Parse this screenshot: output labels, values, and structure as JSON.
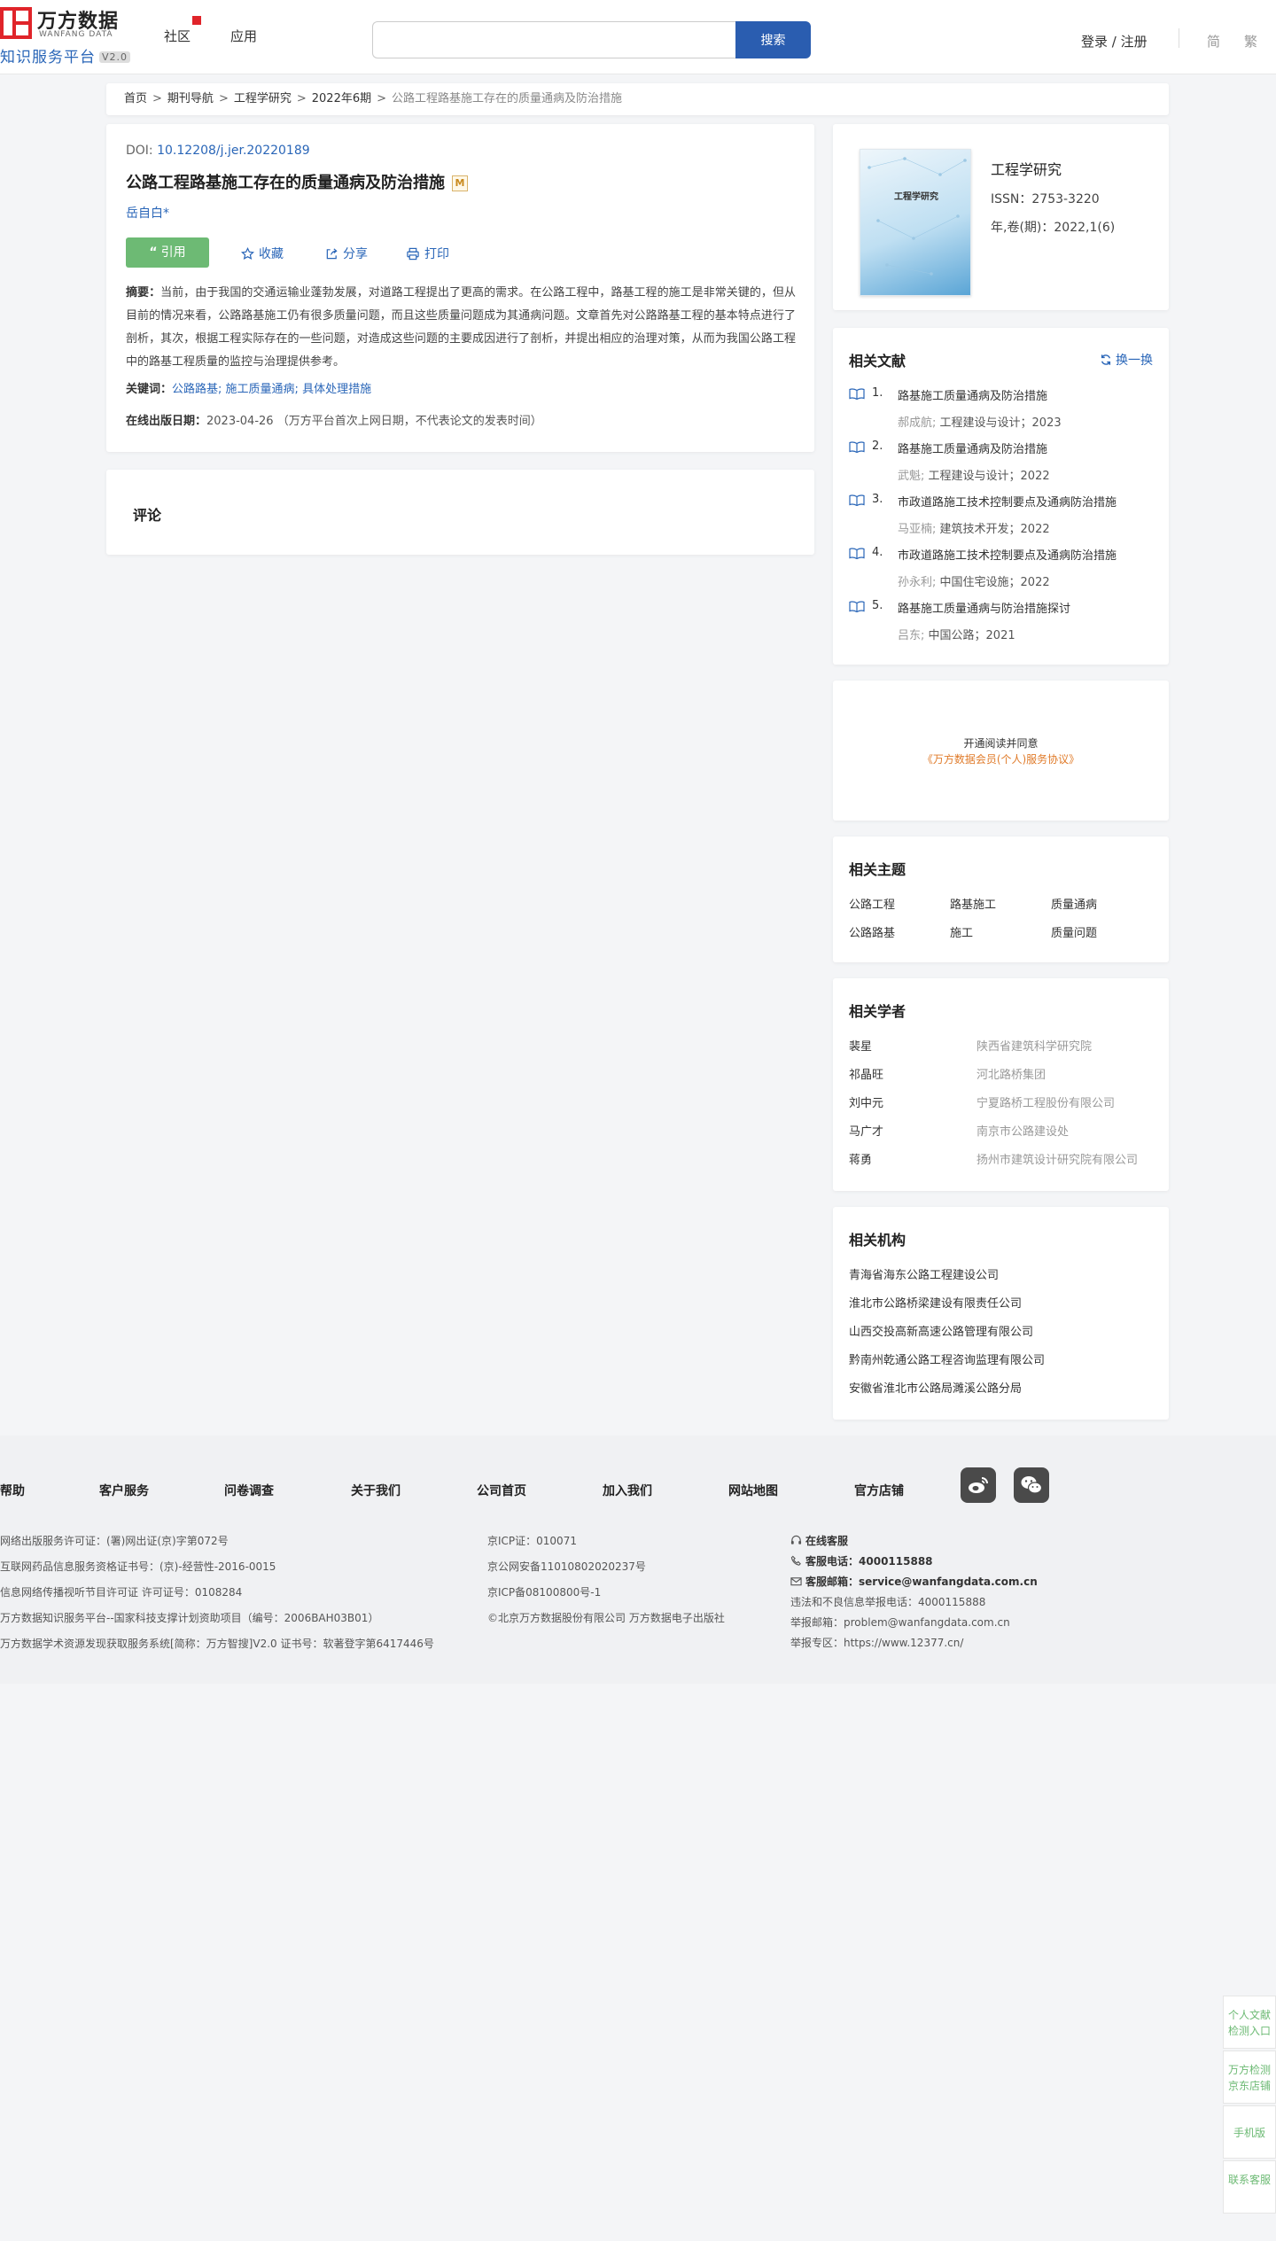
{
  "header": {
    "logo_cn": "万方数据",
    "logo_en": "WANFANG DATA",
    "logo_sub": "知识服务平台",
    "version": "V2.0",
    "nav": [
      "社区",
      "应用"
    ],
    "search_placeholder": "",
    "search_btn": "搜索",
    "login": "登录 / 注册",
    "lang_simplified": "简",
    "lang_traditional": "繁"
  },
  "breadcrumb": {
    "items": [
      "首页",
      "期刊导航",
      "工程学研究",
      "2022年6期"
    ],
    "current": "公路工程路基施工存在的质量通病及防治措施",
    "sep": ">"
  },
  "article": {
    "doi_label": "DOI:",
    "doi": "10.12208/j.jer.20220189",
    "title": "公路工程路基施工存在的质量通病及防治措施",
    "m_badge": "M",
    "author": "岳自白*",
    "cite": "引用",
    "favorite": "收藏",
    "share": "分享",
    "print": "打印",
    "abstract_label": "摘要：",
    "abstract": "当前，由于我国的交通运输业蓬勃发展，对道路工程提出了更高的需求。在公路工程中，路基工程的施工是非常关键的，但从目前的情况来看，公路路基施工仍有很多质量问题，而且这些质量问题成为其通病问题。文章首先对公路路基工程的基本特点进行了剖析，其次，根据工程实际存在的一些问题，对造成这些问题的主要成因进行了剖析，并提出相应的治理对策，从而为我国公路工程中的路基工程质量的监控与治理提供参考。",
    "keywords_label": "关键词：",
    "keywords": [
      "公路路基;",
      "施工质量通病;",
      "具体处理措施"
    ],
    "pubdate_label": "在线出版日期：",
    "pubdate": "2023-04-26",
    "pubdate_note": "（万方平台首次上网日期，不代表论文的发表时间）"
  },
  "comment": {
    "title": "评论"
  },
  "journal": {
    "cover_title": "工程学研究",
    "name": "工程学研究",
    "issn": "ISSN：2753-3220",
    "volume": "年,卷(期)：2022,1(6)"
  },
  "related": {
    "title": "相关文献",
    "refresh": "换一换",
    "items": [
      {
        "num": "1.",
        "title": "路基施工质量通病及防治措施",
        "author": "郝成航;",
        "source": "工程建设与设计；2023"
      },
      {
        "num": "2.",
        "title": "路基施工质量通病及防治措施",
        "author": "武魁;",
        "source": "工程建设与设计；2022"
      },
      {
        "num": "3.",
        "title": "市政道路施工技术控制要点及通病防治措施",
        "author": "马亚楠;",
        "source": "建筑技术开发；2022"
      },
      {
        "num": "4.",
        "title": "市政道路施工技术控制要点及通病防治措施",
        "author": "孙永利;",
        "source": "中国住宅设施；2022"
      },
      {
        "num": "5.",
        "title": "路基施工质量通病与防治措施探讨",
        "author": "吕东;",
        "source": "中国公路；2021"
      }
    ]
  },
  "promo": {
    "line1": "开通阅读并同意",
    "line2": "《万方数据会员(个人)服务协议》"
  },
  "topics": {
    "title": "相关主题",
    "items": [
      "公路工程",
      "路基施工",
      "质量通病",
      "公路路基",
      "施工",
      "质量问题"
    ]
  },
  "scholars": {
    "title": "相关学者",
    "items": [
      {
        "name": "裴星",
        "org": "陕西省建筑科学研究院"
      },
      {
        "name": "祁晶旺",
        "org": "河北路桥集团"
      },
      {
        "name": "刘中元",
        "org": "宁夏路桥工程股份有限公司"
      },
      {
        "name": "马广才",
        "org": "南京市公路建设处"
      },
      {
        "name": "蒋勇",
        "org": "扬州市建筑设计研究院有限公司"
      }
    ]
  },
  "orgs": {
    "title": "相关机构",
    "items": [
      "青海省海东公路工程建设公司",
      "淮北市公路桥梁建设有限责任公司",
      "山西交投高新高速公路管理有限公司",
      "黔南州乾通公路工程咨询监理有限公司",
      "安徽省淮北市公路局濉溪公路分局"
    ]
  },
  "footer": {
    "nav": [
      "帮助",
      "客户服务",
      "问卷调查",
      "关于我们",
      "公司首页",
      "加入我们",
      "网站地图",
      "官方店铺"
    ],
    "col1": [
      "网络出版服务许可证：(署)网出证(京)字第072号",
      "互联网药品信息服务资格证书号：(京)-经营性-2016-0015",
      "信息网络传播视听节目许可证 许可证号：0108284",
      "万方数据知识服务平台--国家科技支撑计划资助项目（编号：2006BAH03B01）",
      "万方数据学术资源发现获取服务系统[简称：万方智搜]V2.0 证书号：软著登字第6417446号"
    ],
    "col2": [
      "京ICP证：010071",
      "京公网安备11010802020237号",
      "京ICP备08100800号-1",
      "©北京万方数据股份有限公司 万方数据电子出版社"
    ],
    "online_service": "在线客服",
    "phone_label": "客服电话：",
    "phone": "4000115888",
    "email_label": "客服邮箱：",
    "email": "service@wanfangdata.com.cn",
    "report_phone": "违法和不良信息举报电话：4000115888",
    "report_email": "举报邮箱：problem@wanfangdata.com.cn",
    "report_site": "举报专区：https://www.12377.cn/"
  },
  "side": {
    "items": [
      "个人文献检测入口",
      "万方检测京东店铺",
      "手机版",
      "联系客服"
    ]
  }
}
